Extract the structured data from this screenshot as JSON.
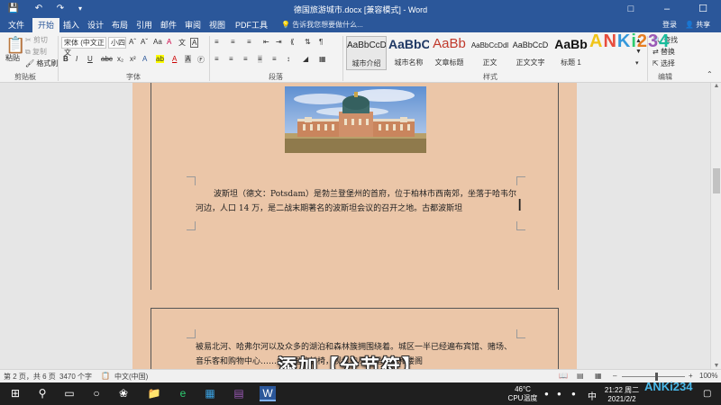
{
  "window": {
    "title": "德国旅游城市.docx [兼容模式] - Word",
    "quick_access": [
      "save-icon",
      "undo-icon",
      "redo-icon",
      "customize-icon"
    ]
  },
  "tabs": [
    {
      "label": "文件"
    },
    {
      "label": "开始"
    },
    {
      "label": "插入"
    },
    {
      "label": "设计"
    },
    {
      "label": "布局"
    },
    {
      "label": "引用"
    },
    {
      "label": "邮件"
    },
    {
      "label": "审阅"
    },
    {
      "label": "视图"
    },
    {
      "label": "PDF工具集"
    }
  ],
  "active_tab": "开始",
  "tell_me": "告诉我您想要做什么...",
  "account": {
    "login": "登录",
    "share": "共享"
  },
  "ribbon": {
    "clipboard": {
      "paste": "粘贴",
      "cut": "剪切",
      "copy": "复制",
      "format_painter": "格式刷",
      "label": "剪贴板"
    },
    "font": {
      "font_name": "宋体 (中文正文",
      "font_size": "小四",
      "label": "字体"
    },
    "paragraph": {
      "label": "段落"
    },
    "styles": {
      "label": "样式",
      "items": [
        {
          "sample": "AaBbCcD",
          "name": "城市介绍"
        },
        {
          "sample": "AaBbC",
          "name": "城市名称"
        },
        {
          "sample": "AaBb",
          "name": "文章标题"
        },
        {
          "sample": "AaBbCcDdl",
          "name": "正文"
        },
        {
          "sample": "AaBbCcD",
          "name": "正文文字"
        },
        {
          "sample": "AaBb",
          "name": "标题 1"
        }
      ]
    },
    "editing": {
      "find": "查找",
      "replace": "替换",
      "select": "选择",
      "label": "编辑"
    }
  },
  "document": {
    "page1_paragraph": "波斯坦（德文：Potsdam）是勃兰登堡州的首府，位于柏林市西南郊，坐落于哈韦尔河边，人口 14 万，是二战末期著名的波斯坦会议的召开之地。古都波斯坦",
    "page2_paragraph": "被易北河、哈弗尔河以及众多的湖泊和森林簇拥围绕着。城区一半已经遍布宾馆、赌场、音乐客和购物中心……公园里的长椅，视线的尽头是宫殿和楼阁"
  },
  "subtitle": "添加【分节符】",
  "statusbar": {
    "page": "第 2 页，共 6 页",
    "words": "3470 个字",
    "language": "中文(中国)",
    "zoom": "100%"
  },
  "taskbar": {
    "temperature": "46°C",
    "cpu_label": "CPU温度",
    "ime": "中",
    "time": "21:22 周二",
    "date": "2021/2/2"
  },
  "watermark": "ANKi234",
  "colors": {
    "word_blue": "#2b579a",
    "page_bg": "#ebc6a8"
  }
}
